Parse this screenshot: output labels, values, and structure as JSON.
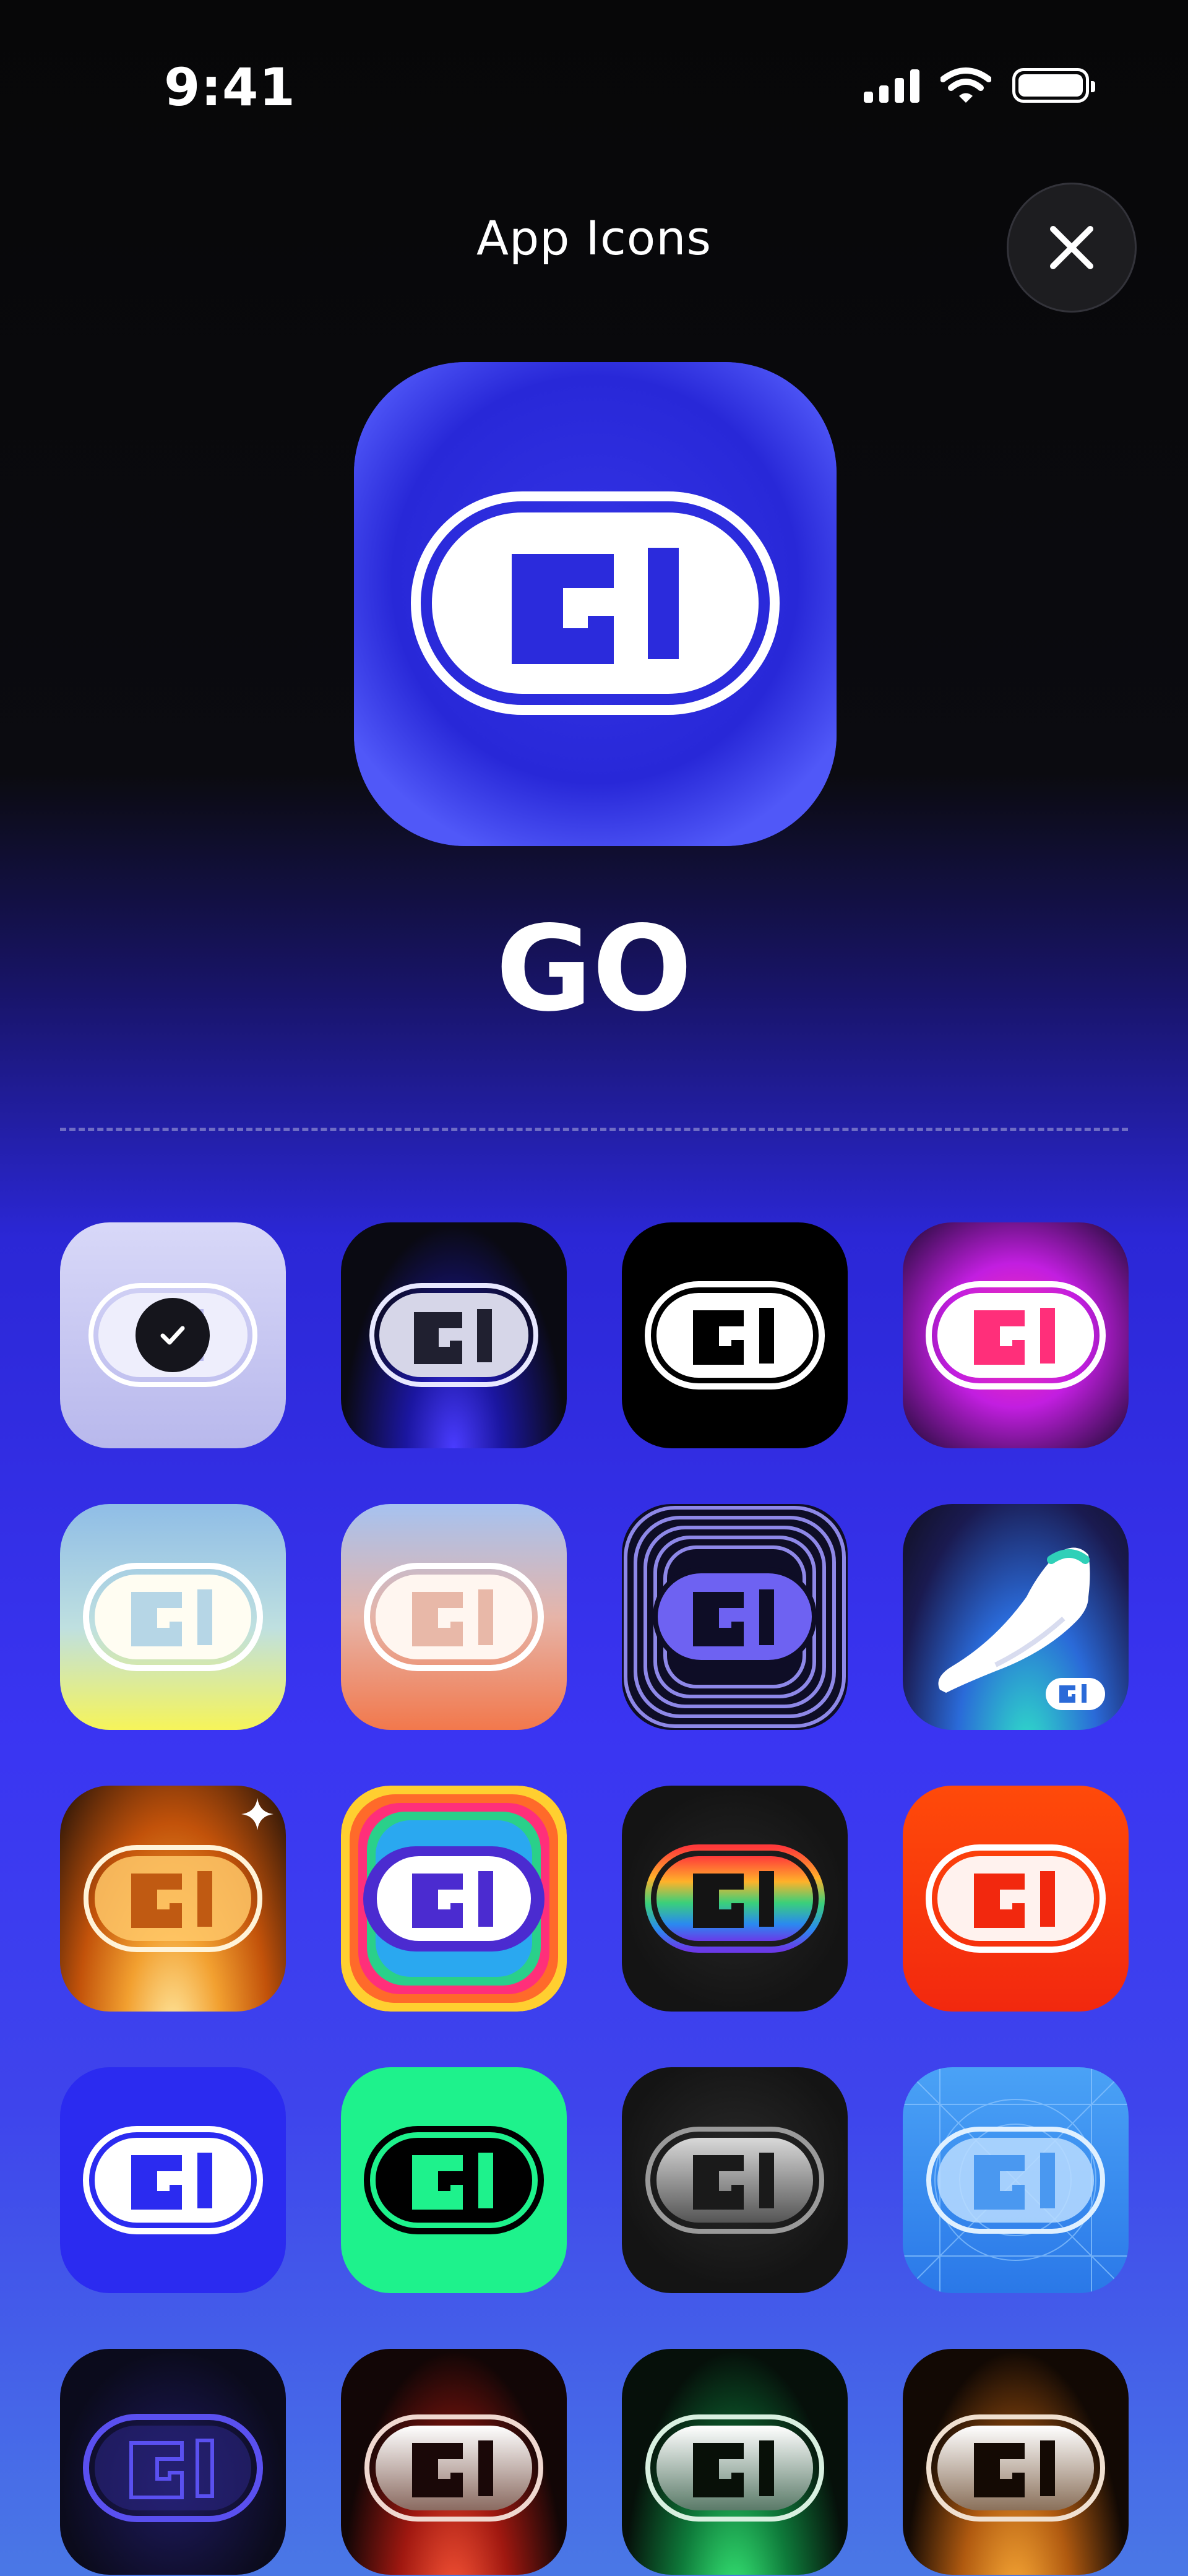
{
  "status_bar": {
    "time": "9:41",
    "signal_icon": "signal-icon",
    "wifi_icon": "wifi-icon",
    "battery_icon": "battery-icon"
  },
  "header": {
    "title": "App Icons",
    "close_icon": "close-icon"
  },
  "current_icon": {
    "name": "GO",
    "background": "#2f2fe0"
  },
  "icons": [
    {
      "id": "lavender",
      "selected": true,
      "bg": "#c8c8f3"
    },
    {
      "id": "dark-blue-glow",
      "selected": false,
      "bg": "#0a0a12"
    },
    {
      "id": "black-classic",
      "selected": false,
      "bg": "#000000"
    },
    {
      "id": "magenta-glow",
      "selected": false,
      "bg": "#c31ee0"
    },
    {
      "id": "sky-sunshine",
      "selected": false,
      "bg": "#9cc8e8"
    },
    {
      "id": "peach-sunset",
      "selected": false,
      "bg": "#e8a890"
    },
    {
      "id": "stripes-purple",
      "selected": false,
      "bg": "#0e0d26"
    },
    {
      "id": "sneaker",
      "selected": false,
      "bg": "#1e3d90"
    },
    {
      "id": "amber-sparkle",
      "selected": false,
      "bg": "#d06a10"
    },
    {
      "id": "rainbow-frame",
      "selected": false,
      "bg": "#4b2bd0"
    },
    {
      "id": "rainbow-logo",
      "selected": false,
      "bg": "#151515"
    },
    {
      "id": "red-orange",
      "selected": false,
      "bg": "#f23a10"
    },
    {
      "id": "classic-blue",
      "selected": false,
      "bg": "#2b2bf0"
    },
    {
      "id": "neon-green",
      "selected": false,
      "bg": "#1ef28c"
    },
    {
      "id": "graphite",
      "selected": false,
      "bg": "#181818"
    },
    {
      "id": "blueprint",
      "selected": false,
      "bg": "#3a8ef0"
    },
    {
      "id": "dark-outline-blue",
      "selected": false,
      "bg": "#0b0b1c"
    },
    {
      "id": "dark-red-glow",
      "selected": false,
      "bg": "#120606"
    },
    {
      "id": "dark-green-glow",
      "selected": false,
      "bg": "#06100a"
    },
    {
      "id": "dark-amber-glow",
      "selected": false,
      "bg": "#120904"
    }
  ]
}
